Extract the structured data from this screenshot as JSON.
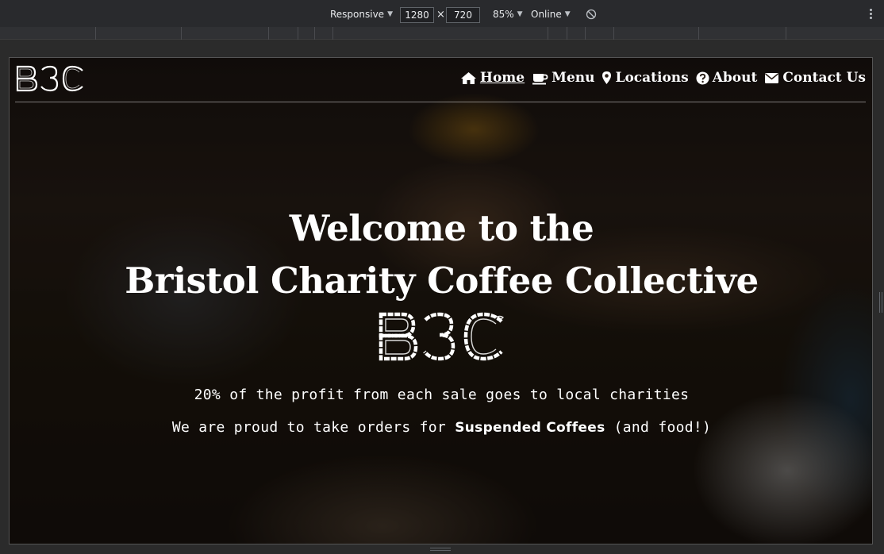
{
  "devtools": {
    "device": "Responsive",
    "width": "1280",
    "height": "720",
    "times": "×",
    "zoom": "85%",
    "network": "Online"
  },
  "site": {
    "logo_text": "B3C",
    "nav": [
      {
        "label": "Home",
        "icon": "home-icon",
        "active": true
      },
      {
        "label": "Menu",
        "icon": "coffee-cup-icon",
        "active": false
      },
      {
        "label": "Locations",
        "icon": "map-marker-icon",
        "active": false
      },
      {
        "label": "About",
        "icon": "question-circle-icon",
        "active": false
      },
      {
        "label": "Contact Us",
        "icon": "envelope-icon",
        "active": false
      }
    ],
    "hero": {
      "title_line1": "Welcome to the",
      "title_line2": "Bristol Charity Coffee Collective",
      "logo_text": "B3C",
      "line1": "20% of the profit from each sale goes to local charities",
      "line2_prefix": "We are proud to take orders for ",
      "line2_strong": "Suspended Coffees",
      "line2_suffix": " (and food!)"
    }
  }
}
